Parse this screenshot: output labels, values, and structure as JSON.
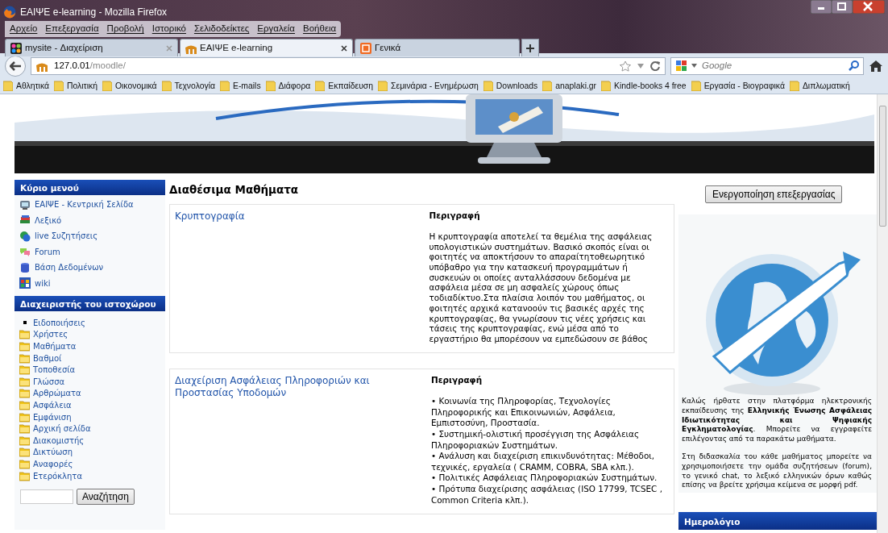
{
  "window": {
    "title": "ΕΑΙΨΕ e-learning - Mozilla Firefox"
  },
  "menu": [
    "Αρχείο",
    "Επεξεργασία",
    "Προβολή",
    "Ιστορικό",
    "Σελιδοδείκτες",
    "Εργαλεία",
    "Βοήθεια"
  ],
  "tabs": [
    {
      "label": "mysite - Διαχείριση",
      "selected": false
    },
    {
      "label": "ΕΑΙΨΕ e-learning",
      "selected": true
    },
    {
      "label": "Γενικά",
      "selected": false
    }
  ],
  "address": {
    "host": "127.0.01",
    "path": "/moodle/"
  },
  "search": {
    "placeholder": "Google"
  },
  "bookmarks": [
    "Αθλητικά",
    "Πολιτική",
    "Οικονομικά",
    "Τεχνολογία",
    "E-mails",
    "Διάφορα",
    "Εκπαίδευση",
    "Σεμινάρια - Ενημέρωση",
    "Downloads",
    "anaplaki.gr",
    "Kindle-books 4 free",
    "Εργασία - Βιογραφικά",
    "Διπλωματική"
  ],
  "main_menu": {
    "title": "Κύριο μενού",
    "items": [
      "ΕΑΙΨΕ - Κεντρική Σελίδα",
      "Λεξικό",
      "live Συζητήσεις",
      "Forum",
      "Βάση Δεδομένων",
      "wiki"
    ]
  },
  "admin_menu": {
    "title": "Διαχειριστής του ιστοχώρου",
    "items": [
      {
        "label": "Ειδοποιήσεις",
        "kind": "bullet"
      },
      {
        "label": "Χρήστες",
        "kind": "folder"
      },
      {
        "label": "Μαθήματα",
        "kind": "folder"
      },
      {
        "label": "Βαθμοί",
        "kind": "folder"
      },
      {
        "label": "Τοποθεσία",
        "kind": "folder"
      },
      {
        "label": "Γλώσσα",
        "kind": "folder"
      },
      {
        "label": "Αρθρώματα",
        "kind": "folder"
      },
      {
        "label": "Ασφάλεια",
        "kind": "folder"
      },
      {
        "label": "Εμφάνιση",
        "kind": "folder"
      },
      {
        "label": "Αρχική σελίδα",
        "kind": "folder"
      },
      {
        "label": "Διακομιστής",
        "kind": "folder"
      },
      {
        "label": "Δικτύωση",
        "kind": "folder"
      },
      {
        "label": "Αναφορές",
        "kind": "folder"
      },
      {
        "label": "Ετερόκλητα",
        "kind": "folder"
      }
    ]
  },
  "site_search": {
    "button": "Αναζήτηση"
  },
  "heading": "Διαθέσιμα Μαθήματα",
  "edit_button": "Ενεργοποίηση επεξεργασίας",
  "courses": [
    {
      "title": "Κρυπτογραφία",
      "description_label": "Περιγραφή",
      "description": [
        "Η κρυπτογραφία αποτελεί τα θεμέλια της ασφάλειας υπολογιστικών συστημάτων. Βασικό σκοπός είναι οι φοιτητές να αποκτήσουν το απαραίτητοθεωρητικό υπόβαθρο για την κατασκευή προγραμμάτων ή συσκευών οι οποίες ανταλλάσσουν δεδομένα με ασφάλεια μέσα σε μη ασφαλείς χώρους όπως τοδιαδίκτυο.Στα πλαίσια λοιπόν του μαθήματος, οι φοιτητές αρχικά κατανοούν τις βασικές αρχές της κρυπτογραφίας, θα γνωρίσουν τις νέες χρήσεις και τάσεις της κρυπτογραφίας, ενώ μέσα από το εργαστήριο θα μπορέσουν να εμπεδώσουν σε βάθος"
      ]
    },
    {
      "title": "Διαχείριση Ασφάλειας Πληροφοριών και Προστασίας Υποδομών",
      "description_label": "Περιγραφή",
      "description": [
        "• Κοινωνία της Πληροφορίας, Τεχνολογίες Πληροφορικής και Επικοινωνιών, Ασφάλεια, Εμπιστοσύνη, Προστασία.",
        "• Συστημική-ολιστική προσέγγιση της Ασφάλειας Πληροφοριακών Συστημάτων.",
        "• Ανάλυση και διαχείριση επικινδυνότητας: Μέθοδοι, τεχνικές, εργαλεία ( CRAMM, COBRA, SBA κλπ.).",
        "• Πολιτικές Ασφάλειας Πληροφοριακών Συστημάτων.",
        "• Πρότυπα διαχείρισης ασφάλειας (ISO 17799, TCSEC , Common Criteria κλπ.)."
      ]
    }
  ],
  "welcome": {
    "paragraphs": [
      "Καλώς ήρθατε στην πλατφόρμα ηλεκτρονικής εκπαίδευσης της **Ελληνικής Ένωσης Ασφάλειας Ιδιωτικότητας και Ψηφιακής Εγκληματολογίας**. Μπορείτε να εγγραφείτε επιλέγοντας από τα παρακάτω μαθήματα.",
      "Στη διδασκαλία του κάθε μαθήματος μπορείτε να χρησιμοποιήσετε την ομάδα συζητήσεων (forum), το γενικό chat, το λεξικό ελληνικών όρων καθώς επίσης να βρείτε χρήσιμα κείμενα σε μορφή pdf."
    ]
  },
  "calendar": {
    "title": "Ημερολόγιο"
  }
}
